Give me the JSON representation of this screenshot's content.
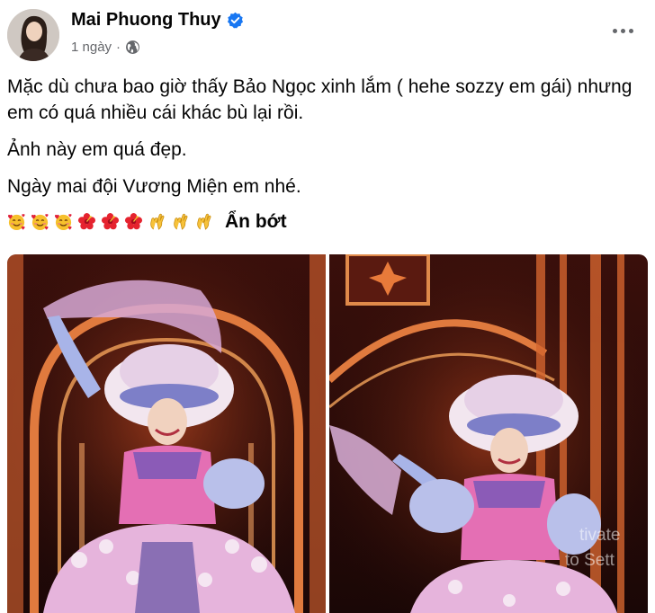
{
  "post": {
    "author": "Mai Phuong Thuy",
    "time": "1 ngày",
    "separator": "·",
    "paragraphs": [
      "Mặc dù chưa bao giờ thấy Bảo Ngọc xinh lắm ( hehe sozzy em gái) nhưng em có quá nhiều cái khác bù lại rồi.",
      "Ảnh này em quá đẹp.",
      "Ngày mai đội Vương Miện em nhé."
    ],
    "emojis": [
      "smiling-face-with-hearts",
      "smiling-face-with-hearts",
      "smiling-face-with-hearts",
      "hibiscus",
      "hibiscus",
      "hibiscus",
      "ok-hand",
      "ok-hand",
      "ok-hand"
    ],
    "see_less": "Ẩn bớt"
  },
  "watermark": {
    "line1": "tivate",
    "line2": "to Sett"
  },
  "colors": {
    "verified": "#1877f2",
    "secondary_text": "#65676b",
    "stage_bg": "#2a0d0a",
    "arch": "#d96a33",
    "costume_pink": "#e46fb4"
  }
}
